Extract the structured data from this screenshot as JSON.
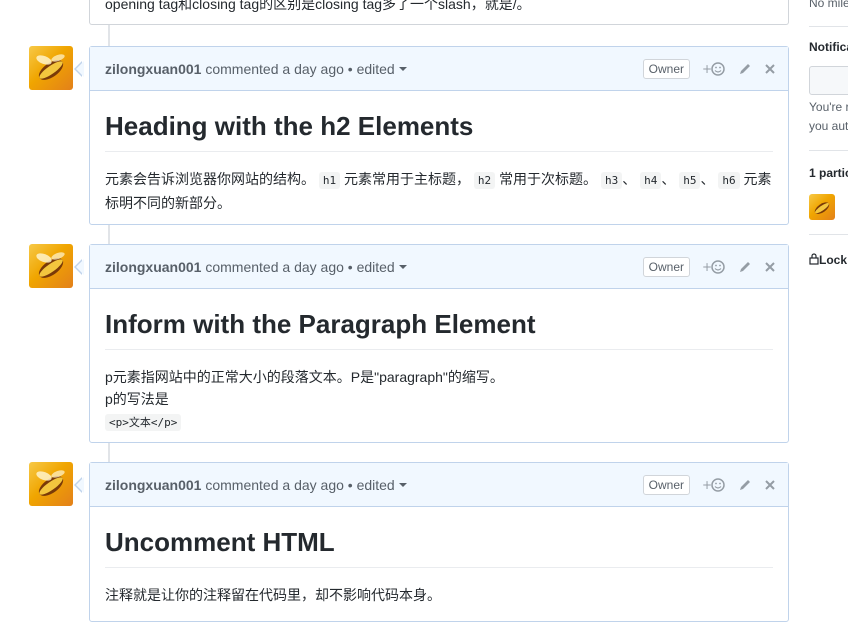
{
  "top_comment": {
    "text": "opening tag和closing tag的区别是closing tag多了一个slash，就是/。"
  },
  "comments": [
    {
      "author": "zilongxuan001",
      "meta": "commented a day ago",
      "separator": "•",
      "edited": "edited",
      "badge": "Owner",
      "heading": "Heading with the h2 Elements",
      "p1_a": "元素会告诉浏览器你网站的结构。",
      "code_h1": "h1",
      "p1_b": "元素常用于主标题，",
      "code_h2": "h2",
      "p1_c": "常用于次标题。",
      "code_h3": "h3",
      "sep1": "、",
      "code_h4": "h4",
      "sep2": "、",
      "code_h5": "h5",
      "sep3": "、",
      "code_h6": "h6",
      "p1_d": "元素标明不同的新部分。"
    },
    {
      "author": "zilongxuan001",
      "meta": "commented a day ago",
      "separator": "•",
      "edited": "edited",
      "badge": "Owner",
      "heading": "Inform with the Paragraph Element",
      "line1": "p元素指网站中的正常大小的段落文本。P是\"paragraph\"的缩写。",
      "line2": "p的写法是",
      "code_line": "<p>文本</p>"
    },
    {
      "author": "zilongxuan001",
      "meta": "commented a day ago",
      "separator": "•",
      "edited": "edited",
      "badge": "Owner",
      "heading": "Uncomment HTML",
      "line1": "注释就是让你的注释留在代码里，却不影响代码本身。"
    }
  ],
  "sidebar": {
    "milestone_text": "No mile",
    "notifications_label": "Notifica",
    "subscribe_text_1": "You're r",
    "subscribe_text_2": "you aut",
    "participants_label": "1 partic",
    "lock_label": "Lock"
  },
  "icons": {
    "add_reaction": "smiley-icon",
    "edit": "pencil-icon",
    "delete": "close-icon",
    "lock": "lock-icon"
  },
  "colors": {
    "header_bg": "#f1f8ff",
    "header_border": "#c0d3eb",
    "text": "#24292e",
    "muted": "#586069"
  }
}
